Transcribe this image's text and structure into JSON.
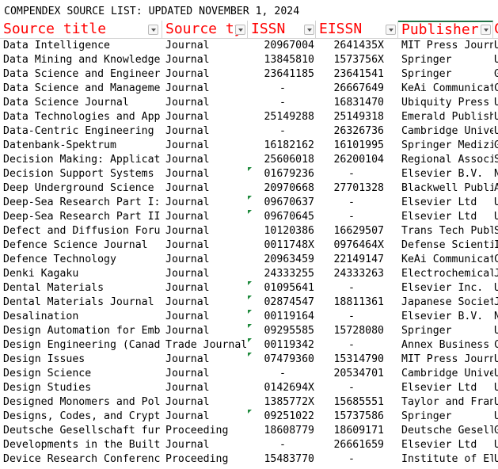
{
  "sheet_title": "COMPENDEX SOURCE LIST: UPDATED NOVEMBER 1, 2024",
  "headers": {
    "source_title": "Source title",
    "source_type": "Source ty",
    "issn": "ISSN",
    "eissn": "EISSN",
    "publisher": "Publisher",
    "next": "C"
  },
  "rows": [
    {
      "title": "Data Intelligence",
      "type": "Journal",
      "issn": "20967004",
      "eissn": "2641435X",
      "publisher": "MIT Press Journ",
      "next": "U",
      "mark": false
    },
    {
      "title": "Data Mining and Knowledge",
      "type": "Journal",
      "issn": "13845810",
      "eissn": "1573756X",
      "publisher": "Springer",
      "next": "U",
      "mark": false
    },
    {
      "title": "Data Science and Engineer",
      "type": "Journal",
      "issn": "23641185",
      "eissn": "23641541",
      "publisher": "Springer",
      "next": "G",
      "mark": false
    },
    {
      "title": "Data Science and Manageme",
      "type": "Journal",
      "issn": "-",
      "eissn": "26667649",
      "publisher": "KeAi Communicat",
      "next": "C",
      "mark": false
    },
    {
      "title": "Data Science Journal",
      "type": "Journal",
      "issn": "-",
      "eissn": "16831470",
      "publisher": "Ubiquity Press",
      "next": "U",
      "mark": false
    },
    {
      "title": "Data Technologies and App",
      "type": "Journal",
      "issn": "25149288",
      "eissn": "25149318",
      "publisher": "Emerald Publish",
      "next": "U",
      "mark": false
    },
    {
      "title": "Data-Centric Engineering",
      "type": "Journal",
      "issn": "-",
      "eissn": "26326736",
      "publisher": "Cambridge Unive",
      "next": "U",
      "mark": false
    },
    {
      "title": "Datenbank-Spektrum",
      "type": "Journal",
      "issn": "16182162",
      "eissn": "16101995",
      "publisher": "Springer Medizi",
      "next": "G",
      "mark": false
    },
    {
      "title": "Decision Making: Applicat",
      "type": "Journal",
      "issn": "25606018",
      "eissn": "26200104",
      "publisher": "Regional Associ",
      "next": "S",
      "mark": false
    },
    {
      "title": "Decision Support Systems",
      "type": "Journal",
      "issn": "01679236",
      "eissn": "-",
      "publisher": "Elsevier B.V.",
      "next": "N",
      "mark": true
    },
    {
      "title": "Deep Underground Science",
      "type": "Journal",
      "issn": "20970668",
      "eissn": "27701328",
      "publisher": "Blackwell Publi",
      "next": "A",
      "mark": false
    },
    {
      "title": "Deep-Sea Research Part I:",
      "type": "Journal",
      "issn": "09670637",
      "eissn": "-",
      "publisher": "Elsevier Ltd",
      "next": "U",
      "mark": true
    },
    {
      "title": "Deep-Sea Research Part II",
      "type": "Journal",
      "issn": "09670645",
      "eissn": "-",
      "publisher": "Elsevier Ltd",
      "next": "U",
      "mark": true
    },
    {
      "title": "Defect and Diffusion Foru",
      "type": "Journal",
      "issn": "10120386",
      "eissn": "16629507",
      "publisher": "Trans Tech Publ",
      "next": "S",
      "mark": false
    },
    {
      "title": "Defence Science Journal",
      "type": "Journal",
      "issn": "0011748X",
      "eissn": "0976464X",
      "publisher": "Defense Scienti",
      "next": "I",
      "mark": false
    },
    {
      "title": "Defence Technology",
      "type": "Journal",
      "issn": "20963459",
      "eissn": "22149147",
      "publisher": "KeAi Communicat",
      "next": "C",
      "mark": false
    },
    {
      "title": "Denki Kagaku",
      "type": "Journal",
      "issn": "24333255",
      "eissn": "24333263",
      "publisher": "Electrochemical",
      "next": "J",
      "mark": false
    },
    {
      "title": "Dental Materials",
      "type": "Journal",
      "issn": "01095641",
      "eissn": "-",
      "publisher": "Elsevier Inc.",
      "next": "U",
      "mark": true
    },
    {
      "title": "Dental Materials Journal",
      "type": "Journal",
      "issn": "02874547",
      "eissn": "18811361",
      "publisher": "Japanese Societ",
      "next": "J",
      "mark": true
    },
    {
      "title": "Desalination",
      "type": "Journal",
      "issn": "00119164",
      "eissn": "-",
      "publisher": "Elsevier B.V.",
      "next": "N",
      "mark": true
    },
    {
      "title": "Design Automation for Emb",
      "type": "Journal",
      "issn": "09295585",
      "eissn": "15728080",
      "publisher": "Springer",
      "next": "U",
      "mark": true
    },
    {
      "title": "Design Engineering (Canad",
      "type": "Trade Journal",
      "issn": "00119342",
      "eissn": "-",
      "publisher": "Annex Business",
      "next": "C",
      "mark": true
    },
    {
      "title": "Design Issues",
      "type": "Journal",
      "issn": "07479360",
      "eissn": "15314790",
      "publisher": "MIT Press Journ",
      "next": "U",
      "mark": true
    },
    {
      "title": "Design Science",
      "type": "Journal",
      "issn": "-",
      "eissn": "20534701",
      "publisher": "Cambridge Unive",
      "next": "U",
      "mark": false
    },
    {
      "title": "Design Studies",
      "type": "Journal",
      "issn": "0142694X",
      "eissn": "-",
      "publisher": "Elsevier Ltd",
      "next": "U",
      "mark": false
    },
    {
      "title": "Designed Monomers and Pol",
      "type": "Journal",
      "issn": "1385772X",
      "eissn": "15685551",
      "publisher": "Taylor and Fran",
      "next": "U",
      "mark": false
    },
    {
      "title": "Designs, Codes, and Crypt",
      "type": "Journal",
      "issn": "09251022",
      "eissn": "15737586",
      "publisher": "Springer",
      "next": "U",
      "mark": true
    },
    {
      "title": "Deutsche Gesellschaft fur",
      "type": "Proceeding",
      "issn": "18608779",
      "eissn": "18609171",
      "publisher": "Deutsche Gesell",
      "next": "G",
      "mark": false
    },
    {
      "title": "Developments in the Built",
      "type": "Journal",
      "issn": "-",
      "eissn": "26661659",
      "publisher": "Elsevier Ltd",
      "next": "U",
      "mark": false
    },
    {
      "title": "Device Research Conferenc",
      "type": "Proceeding",
      "issn": "15483770",
      "eissn": "-",
      "publisher": "Institute of El",
      "next": "U",
      "mark": false
    }
  ]
}
